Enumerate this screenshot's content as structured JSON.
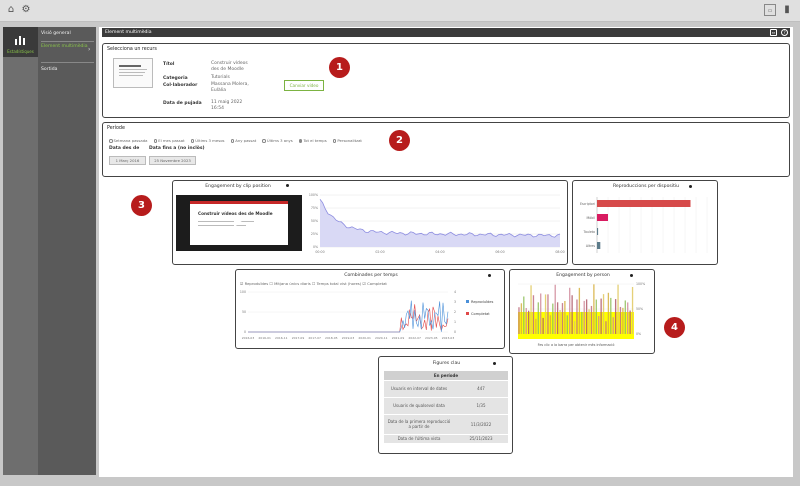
{
  "sidebar": {
    "active_label": "Estadístiques",
    "items": [
      {
        "label": "Visió general"
      },
      {
        "label": "Element multimèdia"
      },
      {
        "label": "Sortida"
      }
    ]
  },
  "panel": {
    "title": "Element multimèdia"
  },
  "resource": {
    "heading": "Selecciona un recurs",
    "fields": [
      {
        "key": "Títol",
        "value": "Construir vídeos des de Moodle"
      },
      {
        "key": "Categoria",
        "value": "Tutorials"
      },
      {
        "key": "Col·laborador",
        "value": "Massana Molera, Eulàlia"
      },
      {
        "key": "Data de pujada",
        "value": "11 maig 2022 16:54"
      }
    ],
    "button_label": "Canviar vídeo"
  },
  "period": {
    "heading": "Període",
    "options": [
      {
        "label": "Setmana passada",
        "selected": false
      },
      {
        "label": "El mes passat",
        "selected": false
      },
      {
        "label": "Últims 3 mesos",
        "selected": false
      },
      {
        "label": "Any passat",
        "selected": false
      },
      {
        "label": "Últims 3 anys",
        "selected": false
      },
      {
        "label": "Tot el temps",
        "selected": true
      },
      {
        "label": "Personalitzat",
        "selected": false
      }
    ],
    "date_from_label": "Data des de",
    "date_to_label": "Data fins a (no inclòs)",
    "date_from": "1 Març 2016",
    "date_to": "25 Novembre 2023"
  },
  "badges": [
    "1",
    "2",
    "3",
    "4"
  ],
  "charts": {
    "clip": {
      "title": "Engagement by clip position",
      "video_title": "Construir vídeos des de Moodle",
      "ylabels": [
        "100%",
        "75%",
        "50%",
        "25%",
        "0%"
      ],
      "xlabels": [
        "00:00",
        "02:00",
        "04:00",
        "06:00",
        "08:00"
      ]
    },
    "device": {
      "title": "Reproduccions per dispositiu",
      "categories": [
        "Escriptori",
        "Mòbil",
        "Tauleta",
        "Altres"
      ],
      "values": [
        85,
        10,
        1,
        3
      ]
    },
    "combined": {
      "title": "Combinades per temps",
      "legend_checks": [
        "Reproduïdes",
        "Mitjana únics diaris",
        "Temps total vist (hores)",
        "Completat"
      ],
      "legend_checked": [
        true,
        false,
        false,
        true
      ],
      "ylabels": [
        "100",
        "50",
        "0"
      ],
      "y2labels": [
        "4",
        "3",
        "2",
        "1",
        "0"
      ],
      "xlabels": [
        "2016-03",
        "2016-01",
        "2016-11",
        "2017-09",
        "2017-07",
        "2018-05",
        "2019-03",
        "2020-01",
        "2020-11",
        "2021-09",
        "2022-07",
        "2023-05",
        "2023-03"
      ],
      "series": [
        {
          "name": "Reproduïdes",
          "color": "#4a90d9"
        },
        {
          "name": "Completat",
          "color": "#e04848"
        }
      ]
    },
    "person": {
      "title": "Engagement by person",
      "ylabels": [
        "100%",
        "50%",
        "0%"
      ],
      "hint": "Fes clic a la barra per obtenir més informació"
    }
  },
  "figures": {
    "title": "Figures clau",
    "section": "En període",
    "rows": [
      {
        "label": "Usuaris en interval de dates",
        "value": "447"
      },
      {
        "label": "Usuaris de qualsevol data",
        "value": "1/35"
      },
      {
        "label": "Data de la primera reproducció a partir de",
        "value": "11/3/2022"
      },
      {
        "label": "Data de l'última vista",
        "value": "25/11/2023"
      }
    ]
  },
  "colors": {
    "accent": "#7cb342",
    "badge": "#b71c1c",
    "bar": "#d64a4a",
    "line": "#8c8ce0"
  }
}
